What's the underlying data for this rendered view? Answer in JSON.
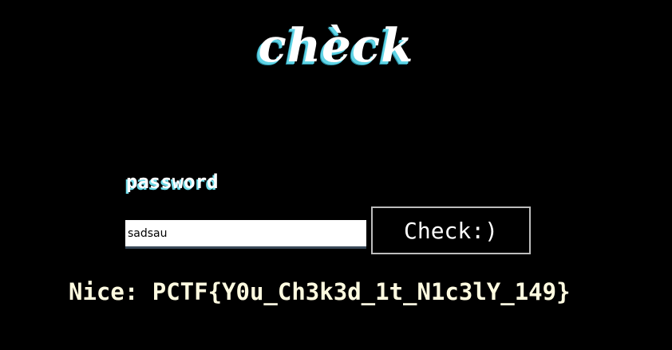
{
  "logo": {
    "text": "chèck"
  },
  "form": {
    "password_label": "password",
    "password_value": "sadsau",
    "check_button_label": "Check:)"
  },
  "result": {
    "message": "Nice: PCTF{Y0u_Ch3k3d_1t_N1c3lY_149}"
  },
  "colors": {
    "background": "#000000",
    "logo_shadow": "#5fd4e6",
    "label_shadow": "#6fdbe8",
    "result_text": "#fffbe0",
    "button_border": "#bdbdbd"
  }
}
